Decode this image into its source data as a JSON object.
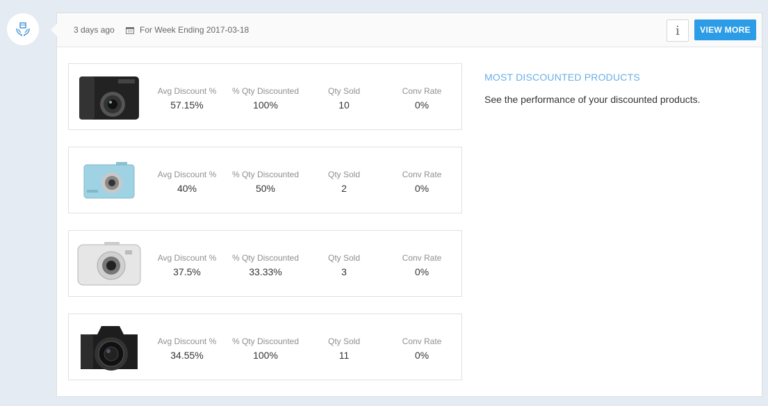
{
  "header": {
    "time_ago": "3 days ago",
    "week_label": "For Week Ending 2017-03-18",
    "info_label": "i",
    "view_more_label": "VIEW MORE"
  },
  "side": {
    "title": "MOST DISCOUNTED PRODUCTS",
    "description": "See the performance of your discounted products."
  },
  "metric_labels": {
    "avg_discount": "Avg Discount %",
    "qty_discounted": "% Qty Discounted",
    "qty_sold": "Qty Sold",
    "conv_rate": "Conv Rate"
  },
  "products": [
    {
      "image": "black-compact-camera",
      "avg_discount": "57.15%",
      "qty_discounted": "100%",
      "qty_sold": "10",
      "conv_rate": "0%"
    },
    {
      "image": "blue-compact-camera",
      "avg_discount": "40%",
      "qty_discounted": "50%",
      "qty_sold": "2",
      "conv_rate": "0%"
    },
    {
      "image": "silver-compact-camera",
      "avg_discount": "37.5%",
      "qty_discounted": "33.33%",
      "qty_sold": "3",
      "conv_rate": "0%"
    },
    {
      "image": "black-dslr-camera",
      "avg_discount": "34.55%",
      "qty_discounted": "100%",
      "qty_sold": "11",
      "conv_rate": "0%"
    }
  ],
  "colors": {
    "accent": "#2d9ce6",
    "title": "#6aaee6",
    "background": "#e4ebf2"
  }
}
